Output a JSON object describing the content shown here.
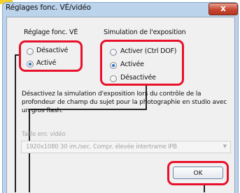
{
  "window": {
    "title": "Réglages fonc. VÉ/vidéo",
    "close_label": "x"
  },
  "left_group": {
    "title": "Réglage fonc. VÉ",
    "options": [
      "Désactivé",
      "Activé"
    ],
    "selected": "Activé"
  },
  "right_group": {
    "title": "Simulation de l'exposition",
    "options": [
      "Activer (Ctrl DOF)",
      "Activée",
      "Désactivée"
    ],
    "selected": "Activée"
  },
  "description": {
    "line1": "Désactivez la simulation d'exposition lors du contrôle de la",
    "line2": "profondeur de champ du sujet pour la photographie en studio avec",
    "line3": "un gros flash."
  },
  "video_size": {
    "label": "Taille enr. vidéo",
    "value": "1920x1080  30 im./sec. Compr. élevée intertrame IPB"
  },
  "buttons": {
    "ok": "OK"
  },
  "colors": {
    "highlight": "#e8102a",
    "radio_selected": "#2b6fc4"
  }
}
